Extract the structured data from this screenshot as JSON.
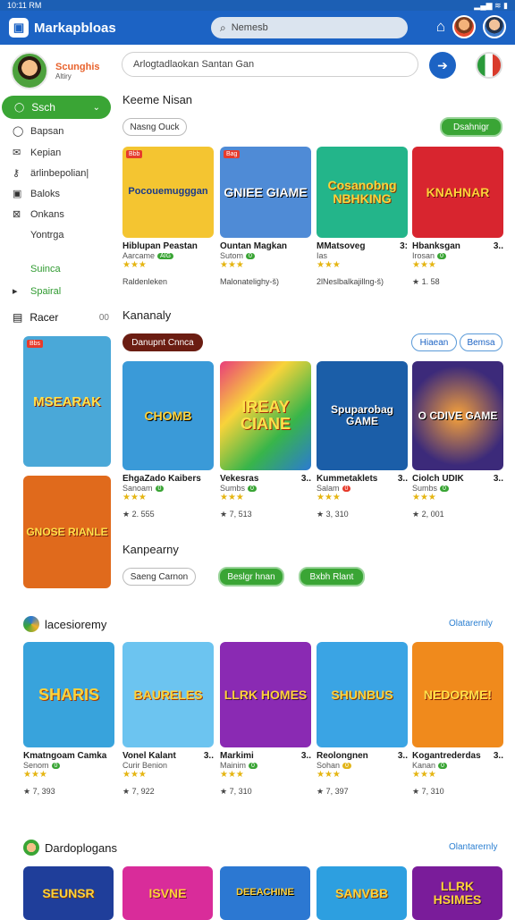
{
  "status": {
    "time": "10:11 RM",
    "signal": "▂▄▆ ≋ ▮"
  },
  "topbar": {
    "title": "Markapbloas",
    "search_placeholder": "Nemesb"
  },
  "brand": {
    "name": "Scunghis",
    "sub": "Altiry"
  },
  "sidebar": {
    "active": "Ssch",
    "items": [
      {
        "label": "Bapsan",
        "icon": "circle-icon"
      },
      {
        "label": "Kepian",
        "icon": "mail-icon"
      },
      {
        "label": "ärlinbepolian|",
        "icon": "key-icon"
      },
      {
        "label": "Baloks",
        "icon": "image-icon"
      },
      {
        "label": "Onkans",
        "icon": "id-icon"
      },
      {
        "label": "Yontrga",
        "icon": ""
      },
      {
        "label": "Suinca",
        "icon": ""
      },
      {
        "label": "Spairal",
        "icon": "play-icon"
      }
    ],
    "section": {
      "label": "Racer",
      "count": "00"
    }
  },
  "main_search": {
    "placeholder": "Arlogtadlaokan Santan Gan"
  },
  "sections": [
    {
      "title": "Keeme Nisan",
      "chip": "Nasng Ouck",
      "action": "Dsahnigr"
    },
    {
      "title": "Kananaly",
      "chip": "Danupnt Cnnca",
      "filters": [
        "Hiaean",
        "Bemsa"
      ]
    },
    {
      "title": "Kanpearny",
      "chip": "Saeng Carnon",
      "actions": [
        "Beslgr hnan",
        "Bxbh Rlant"
      ]
    },
    {
      "title": "lacesioremy",
      "link": "Olatarernly"
    },
    {
      "title": "Dardoplogans",
      "link": "Olantarernly"
    }
  ],
  "row1": [
    {
      "name": "Hiblupan Peastan",
      "side": "",
      "dev": "Aarcame",
      "pill": "AIG",
      "meta": "Raldenleken",
      "thumb": "Pocouemugggan",
      "bg": "#f4c531"
    },
    {
      "name": "Ountan Magkan",
      "side": "",
      "dev": "Sutom",
      "pill": "0",
      "meta": "Malonatelighy-š)",
      "thumb": "GNIEE GIAME",
      "bg": "#4f8bd6"
    },
    {
      "name": "MMatsoveg",
      "side": "3:",
      "dev": "Ias",
      "pill": "",
      "meta": "2lNeslbalkajillng-š)",
      "thumb": "Cosanobng NBHKING",
      "bg": "#23b58a"
    },
    {
      "name": "Hbanksgan",
      "side": "3..",
      "dev": "Irosan",
      "pill": "0",
      "meta": "★ 1. 58",
      "thumb": "KNAHNAR",
      "bg": "#d8252f"
    }
  ],
  "row2_left": {
    "thumb": "MSEARAK",
    "bg": "#4aa8d8"
  },
  "row2": [
    {
      "name": "EhgaZado Kaibers",
      "side": "",
      "dev": "Sanoam",
      "pill": "0",
      "meta": "★ 2. 555",
      "thumb": "CHOMB",
      "bg": "#3a9ad8"
    },
    {
      "name": "Vekesras",
      "side": "3..",
      "dev": "Sumbs",
      "pill": "0",
      "meta": "★ 7, 513",
      "thumb": "IREAY CIANE",
      "bg": "#e93d7a"
    },
    {
      "name": "Kummetaklets",
      "side": "3..",
      "dev": "Salam",
      "pill": "0",
      "pillc": "red",
      "meta": "★ 3, 310",
      "thumb": "Spuparobag GAME",
      "bg": "#1b5ea8"
    },
    {
      "name": "Ciolch UDIK",
      "side": "3..",
      "dev": "Sumbs",
      "pill": "0",
      "meta": "★ 2, 001",
      "thumb": "O CDIVE GAME",
      "bg": "#3c2a7a"
    }
  ],
  "row3_left": {
    "thumb": "GNOSE RIANLE",
    "bg": "#e06a1c"
  },
  "row4": [
    {
      "name": "Kmatngoam Camka",
      "side": "",
      "dev": "Senom",
      "pill": "0",
      "meta": "★ 7, 393",
      "thumb": "SHARIS",
      "bg": "#38a3dc"
    },
    {
      "name": "Vonel Kalant",
      "side": "3..",
      "dev": "Curir Benion",
      "pill": "",
      "meta": "★ 7, 922",
      "thumb": "BAURELES",
      "bg": "#6cc4f0"
    },
    {
      "name": "Markimi",
      "side": "3..",
      "dev": "Mainim",
      "pill": "0",
      "meta": "★ 7, 310",
      "thumb": "LLRK HOMES",
      "bg": "#8a2ab3"
    },
    {
      "name": "Reolongnen",
      "side": "3..",
      "dev": "Sohan",
      "pill": "0",
      "pillc": "yel",
      "meta": "★ 7, 397",
      "thumb": "SHUNBUS",
      "bg": "#3aa4e4"
    },
    {
      "name": "Kogantrederdas",
      "side": "3..",
      "dev": "Kanan",
      "pill": "0",
      "meta": "★ 7, 310",
      "thumb": "NEDORME!",
      "bg": "#f08a1c"
    }
  ],
  "row5": [
    {
      "thumb": "SEUNSR",
      "bg": "#1f3e9a"
    },
    {
      "thumb": "ISVNE",
      "bg": "#d92c9a"
    },
    {
      "thumb": "DEEACHINE",
      "bg": "#2c78d2"
    },
    {
      "thumb": "SANVBB",
      "bg": "#2d9fe0"
    },
    {
      "thumb": "LLRK HSIMES",
      "bg": "#7a1c9a"
    }
  ]
}
